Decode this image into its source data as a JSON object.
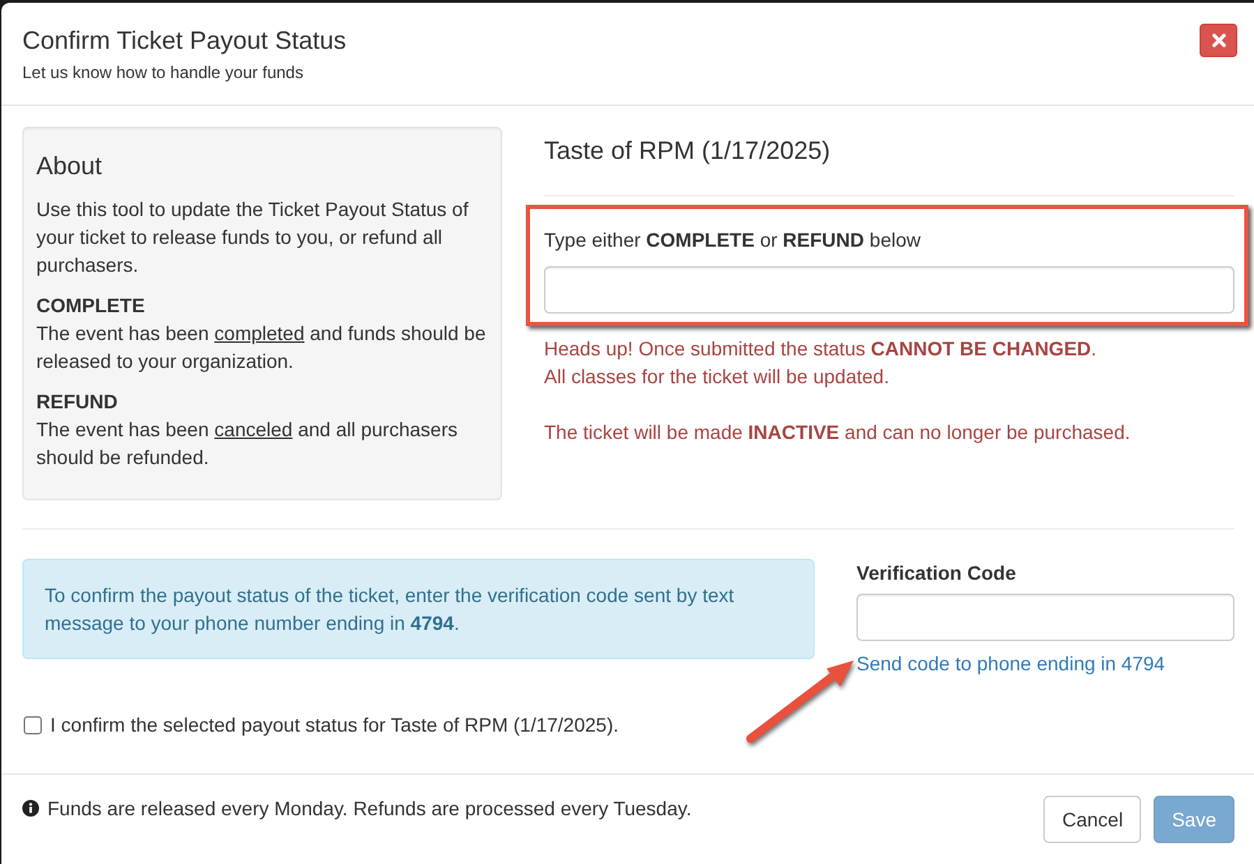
{
  "modal": {
    "title": "Confirm Ticket Payout Status",
    "subtitle": "Let us know how to handle your funds"
  },
  "about": {
    "heading": "About",
    "intro": "Use this tool to update the Ticket Payout Status of your ticket to release funds to you, or refund all purchasers.",
    "statuses": [
      {
        "term": "COMPLETE",
        "before": "The event has been ",
        "underlined": "completed",
        "after": " and funds should be released to your organization."
      },
      {
        "term": "REFUND",
        "before": "The event has been ",
        "underlined": "canceled",
        "after": " and all purchasers should be refunded."
      }
    ]
  },
  "event": {
    "title": "Taste of RPM (1/17/2025)"
  },
  "status_entry": {
    "highlighted": true,
    "label": "Type either **COMPLETE** or **REFUND** below"
  },
  "warning_groups": [
    {
      "lines": [
        "Heads up! Once submitted the status **CANNOT BE CHANGED**.",
        "All classes for the ticket will be updated."
      ]
    },
    {
      "lines": [
        "The ticket will be made **INACTIVE** and can no longer be purchased."
      ]
    }
  ],
  "verification": {
    "notice": "To confirm the payout status of the ticket, enter the verification code sent by text message to your phone number ending in **4794**.",
    "label": "Verification Code",
    "send_link": {
      "text": "Send code to phone ending in 4794",
      "arrow_callout": true
    }
  },
  "confirm": {
    "label": "I confirm the selected payout status for Taste of RPM (1/17/2025).",
    "checked": false
  },
  "footer": {
    "note": "Funds are released every Monday. Refunds are processed every Tuesday.",
    "buttons": [
      {
        "label": "Cancel",
        "kind": "default",
        "disabled": false
      },
      {
        "label": "Save",
        "kind": "primary",
        "disabled": true
      }
    ]
  }
}
